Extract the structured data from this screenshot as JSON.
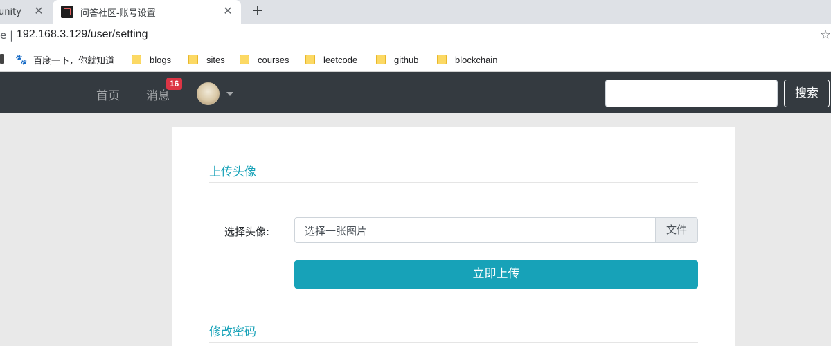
{
  "browser": {
    "tabs": [
      {
        "title": "unity",
        "close": "✕"
      },
      {
        "title": "问答社区-账号设置",
        "close": "✕"
      }
    ],
    "new_tab": "+",
    "address": {
      "left_fragment": "e |",
      "url": "192.168.3.129/user/setting",
      "star": "☆"
    },
    "bookmarks": [
      {
        "label": "百度一下，你就知道",
        "icon": "paw-icon"
      },
      {
        "label": "blogs",
        "icon": "folder-icon"
      },
      {
        "label": "sites",
        "icon": "folder-icon"
      },
      {
        "label": "courses",
        "icon": "folder-icon"
      },
      {
        "label": "leetcode",
        "icon": "folder-icon"
      },
      {
        "label": "github",
        "icon": "folder-icon"
      },
      {
        "label": "blockchain",
        "icon": "folder-icon"
      }
    ]
  },
  "navbar": {
    "home": "首页",
    "messages": "消息",
    "message_count": "16",
    "search": {
      "placeholder": "",
      "button": "搜索"
    }
  },
  "main": {
    "upload_section": {
      "title": "上传头像",
      "field_label": "选择头像:",
      "file_placeholder": "选择一张图片",
      "browse_label": "文件",
      "submit_label": "立即上传"
    },
    "password_section": {
      "title": "修改密码"
    }
  },
  "colors": {
    "navbar_bg": "#343a40",
    "accent": "#17a2b8",
    "badge": "#dc3545",
    "page_bg": "#e9e9e9"
  }
}
